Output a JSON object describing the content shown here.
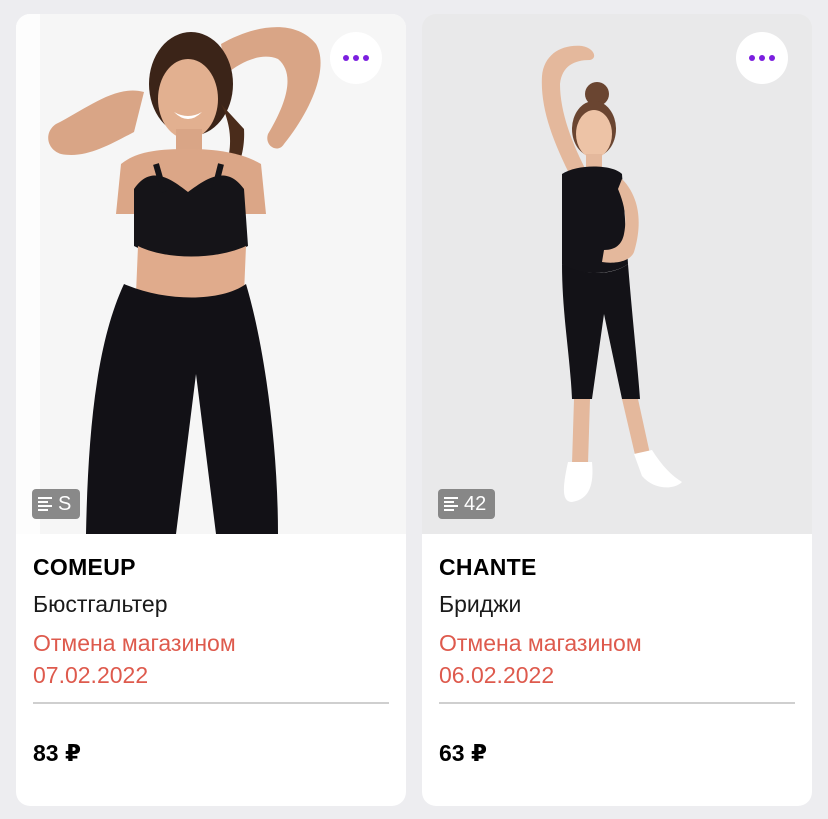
{
  "accent_color": "#7b1fdf",
  "status_color": "#de5a4d",
  "products": [
    {
      "brand": "COMEUP",
      "name": "Бюстгальтер",
      "status": "Отмена магазином",
      "date": "07.02.2022",
      "price": "83 ₽",
      "size": "S",
      "menu_icon": "more-dots-icon",
      "size_icon": "size-lines-icon"
    },
    {
      "brand": "CHANTE",
      "name": "Бриджи",
      "status": "Отмена магазином",
      "date": "06.02.2022",
      "price": "63 ₽",
      "size": "42",
      "menu_icon": "more-dots-icon",
      "size_icon": "size-lines-icon"
    }
  ]
}
